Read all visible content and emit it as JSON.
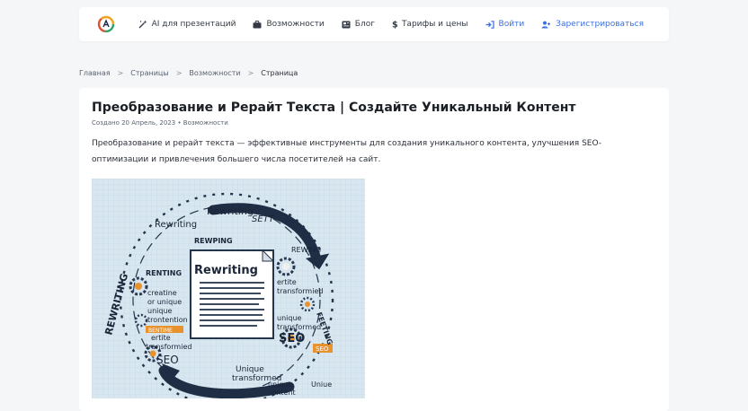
{
  "header": {
    "logo_icon": "ai-ring-logo",
    "nav": [
      {
        "label": "AI для презентаций",
        "icon": "magic-wand-icon",
        "accent": false
      },
      {
        "label": "Возможности",
        "icon": "briefcase-icon",
        "accent": false
      },
      {
        "label": "Блог",
        "icon": "newspaper-icon",
        "accent": false
      },
      {
        "label": "Тарифы и цены",
        "icon": "dollar-icon",
        "accent": false
      },
      {
        "label": "Войти",
        "icon": "sign-in-icon",
        "accent": true
      },
      {
        "label": "Зарегистрироваться",
        "icon": "user-plus-icon",
        "accent": true
      }
    ]
  },
  "breadcrumb": {
    "items": [
      "Главная",
      "Страницы",
      "Возможности",
      "Страница"
    ],
    "separator": ">"
  },
  "article": {
    "title": "Преобразование и Рерайт Текста | Создайте Уникальный Контент",
    "meta": "Создано 20 Апрель, 2023 • Возможности",
    "intro": "Преобразование и рерайт текста — эффективные инструменты для создания уникального контента, улучшения SEO-оптимизации и привлечения большего числа посетителей на сайт.",
    "image": {
      "words": {
        "doc_label": "Rewriting",
        "top_1": "Rewriting",
        "top_2": "SETT",
        "left_1": "Rewriting",
        "mid_1": "REWPING",
        "right_1": "REWING",
        "left_2": "RENTING",
        "l_1": "creatine",
        "l_2": "or unique",
        "l_3": "unique",
        "l_4": "trontention",
        "l_5": "BENTIME",
        "l_6": "ertite",
        "l_7": "transformied",
        "l_8": "SEO",
        "r_1": "ertite",
        "r_2": "transformied",
        "r_3": "SEO",
        "r_4": "unique",
        "r_5": "transformed",
        "r_6": "SEO",
        "r_7": "FEETING",
        "b_1": "Unique",
        "b_2": "transformed",
        "b_3": "unique",
        "b_4": "content",
        "b_5": "Uniue",
        "arc_left": "REWRITING"
      }
    }
  }
}
